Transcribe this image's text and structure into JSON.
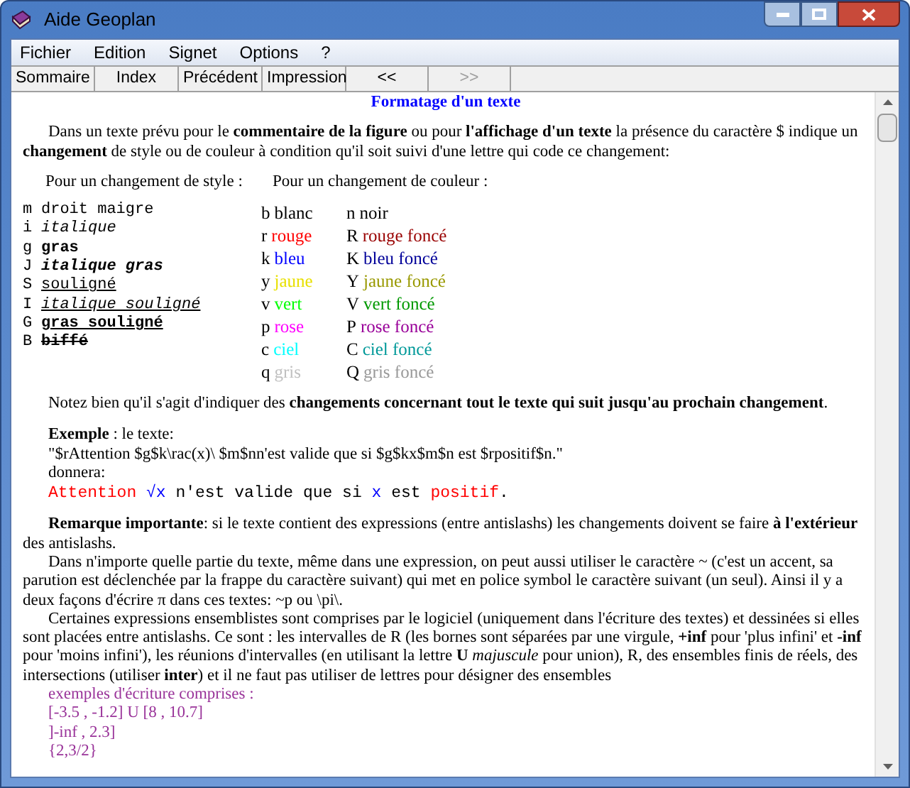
{
  "window": {
    "title": "Aide Geoplan"
  },
  "menu": [
    "Fichier",
    "Edition",
    "Signet",
    "Options",
    "?"
  ],
  "toolbar": [
    {
      "label": "Sommaire",
      "disabled": false
    },
    {
      "label": "Index",
      "disabled": false
    },
    {
      "label": "Précédent",
      "disabled": false
    },
    {
      "label": "Impression",
      "disabled": false
    },
    {
      "label": "<<",
      "disabled": false
    },
    {
      "label": ">>",
      "disabled": true
    }
  ],
  "heading": "Formatage d'un texte",
  "intro": "Dans un texte prévu pour le **commentaire de la figure** ou pour **l'affichage d'un texte** la présence du caractère $ indique un **changement** de style ou de couleur à condition qu'il soit suivi d'une lettre qui code ce changement:",
  "style_header": "Pour un changement de style :",
  "color_header": "Pour un changement de couleur :",
  "styles": [
    {
      "code": "m",
      "label": "droit maigre",
      "kind": "plain"
    },
    {
      "code": "i",
      "label": "italique",
      "kind": "italic"
    },
    {
      "code": "g",
      "label": "gras",
      "kind": "bold"
    },
    {
      "code": "J",
      "label": "italique gras",
      "kind": "bolditalic"
    },
    {
      "code": "S",
      "label": "souligné",
      "kind": "underline"
    },
    {
      "code": "I",
      "label": "italique souligné",
      "kind": "italicunderline"
    },
    {
      "code": "G",
      "label": "gras souligné",
      "kind": "boldunderline"
    },
    {
      "code": "B",
      "label": "biffé",
      "kind": "strike"
    }
  ],
  "color_rows": [
    {
      "light": {
        "code": "b",
        "label": "blanc",
        "color": "#000000"
      },
      "dark": {
        "code": "n",
        "label": "noir",
        "color": "#000000"
      }
    },
    {
      "light": {
        "code": "r",
        "label": "rouge",
        "color": "#ff0000"
      },
      "dark": {
        "code": "R",
        "label": "rouge foncé",
        "color": "#990000"
      }
    },
    {
      "light": {
        "code": "k",
        "label": "bleu",
        "color": "#0000ff"
      },
      "dark": {
        "code": "K",
        "label": "bleu foncé",
        "color": "#000099"
      }
    },
    {
      "light": {
        "code": "y",
        "label": "jaune",
        "color": "#e8e000"
      },
      "dark": {
        "code": "Y",
        "label": "jaune foncé",
        "color": "#999900"
      }
    },
    {
      "light": {
        "code": "v",
        "label": "vert",
        "color": "#00ff00"
      },
      "dark": {
        "code": "V",
        "label": "vert foncé",
        "color": "#009900"
      }
    },
    {
      "light": {
        "code": "p",
        "label": "rose",
        "color": "#ff00ff"
      },
      "dark": {
        "code": "P",
        "label": "rose foncé",
        "color": "#990099"
      }
    },
    {
      "light": {
        "code": "c",
        "label": "ciel",
        "color": "#00ffff"
      },
      "dark": {
        "code": "C",
        "label": "ciel foncé",
        "color": "#009999"
      }
    },
    {
      "light": {
        "code": "q",
        "label": "gris",
        "color": "#c0c0c0"
      },
      "dark": {
        "code": "Q",
        "label": "gris foncé",
        "color": "#999999"
      }
    }
  ],
  "note": "Notez bien qu'il s'agit d'indiquer des **changements concernant tout le texte qui suit jusqu'au prochain changement**.",
  "example_label": "**Exemple** : le texte:",
  "example_source": "\"$rAttention $g$k\\rac(x)\\ $m$nn'est valide que si $g$kx$m$n est $rpositif$n.\"",
  "example_gives": "donnera:",
  "example_output": [
    {
      "text": "Attention ",
      "color": "#ff0000"
    },
    {
      "text": "√x",
      "color": "#0000ff"
    },
    {
      "text": " n'est valide que si ",
      "color": "#000000"
    },
    {
      "text": "x",
      "color": "#0000ff"
    },
    {
      "text": " est ",
      "color": "#000000"
    },
    {
      "text": "positif",
      "color": "#ff0000"
    },
    {
      "text": ".",
      "color": "#000000"
    }
  ],
  "paragraphs": [
    "**Remarque importante**: si le texte contient des expressions (entre antislashs) les changements doivent se faire **à l'extérieur** des antislashs.",
    "Dans n'importe quelle partie du texte, même dans une expression, on peut aussi utiliser le caractère ~ (c'est un accent, sa parution est déclenchée par la frappe du caractère suivant) qui met en police symbol le caractère suivant (un seul). Ainsi il y a deux façons d'écrire π dans ces textes: ~p ou \\pi\\.",
    "Certaines expressions ensemblistes sont comprises par le logiciel (uniquement dans l'écriture des textes) et dessinées si elles sont placées entre antislashs. Ce sont : les intervalles de R (les bornes sont séparées par une virgule, **+inf** pour 'plus infini' et **-inf** pour 'moins infini'), les réunions d'intervalles (en utilisant la lettre **U** *majuscule* pour union), R, des ensembles finis de réels, des intersections (utiliser **inter**) et il ne faut pas utiliser de lettres pour désigner des ensembles"
  ],
  "examples_title": "exemples d'écriture comprises :",
  "examples": [
    "[-3.5 , -1.2] U [8 , 10.7]",
    "]-inf , 2.3]",
    "{2,3/2}"
  ]
}
